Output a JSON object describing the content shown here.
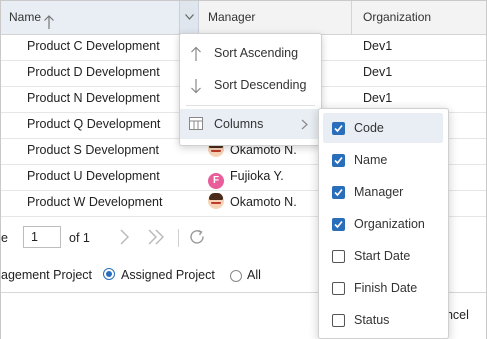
{
  "grid": {
    "headers": {
      "name": "Name",
      "manager": "Manager",
      "organization": "Organization"
    },
    "rows": [
      {
        "name": "Product C Development",
        "manager": "",
        "avatar": "",
        "organization": "Dev1"
      },
      {
        "name": "Product D Development",
        "manager": "",
        "avatar": "",
        "organization": "Dev1"
      },
      {
        "name": "Product N Development",
        "manager": "",
        "avatar": "",
        "organization": "Dev1"
      },
      {
        "name": "Product Q Development",
        "manager": "",
        "avatar": "",
        "organization": ""
      },
      {
        "name": "Product S Development",
        "manager": "Okamoto N.",
        "avatar": "face",
        "organization": ""
      },
      {
        "name": "Product U Development",
        "manager": "Fujioka Y.",
        "avatar": "F",
        "organization": ""
      },
      {
        "name": "Product W Development",
        "manager": "Okamoto N.",
        "avatar": "face",
        "organization": ""
      }
    ]
  },
  "pager": {
    "prefix": "e",
    "page": "1",
    "of_label": "of 1"
  },
  "filters": {
    "option1": "agement Project",
    "option2": "Assigned Project",
    "option3": "All",
    "selected": "option2"
  },
  "footer": {
    "cancel": "ancel"
  },
  "header_menu": {
    "items": [
      {
        "label": "Sort Ascending",
        "icon": "arrow-up-icon"
      },
      {
        "label": "Sort Descending",
        "icon": "arrow-down-icon"
      },
      {
        "label": "Columns",
        "icon": "columns-icon"
      }
    ]
  },
  "columns_menu": {
    "items": [
      {
        "label": "Code",
        "checked": true
      },
      {
        "label": "Name",
        "checked": true
      },
      {
        "label": "Manager",
        "checked": true
      },
      {
        "label": "Organization",
        "checked": true
      },
      {
        "label": "Start Date",
        "checked": false
      },
      {
        "label": "Finish Date",
        "checked": false
      },
      {
        "label": "Status",
        "checked": false
      }
    ]
  },
  "colors": {
    "accent": "#2a6ebb",
    "highlight": "#e9eef4",
    "header_bg": "#f3f3f3"
  }
}
